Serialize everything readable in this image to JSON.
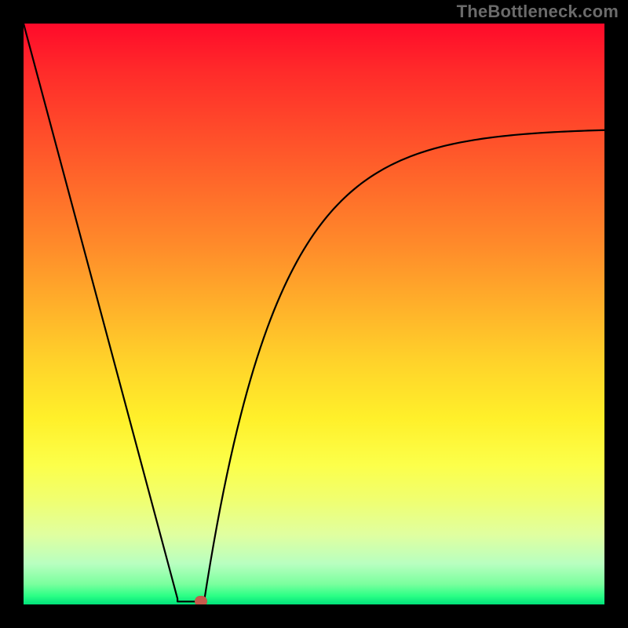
{
  "watermark": "TheBottleneck.com",
  "chart_data": {
    "type": "line",
    "title": "",
    "xlabel": "",
    "ylabel": "",
    "xlim": [
      0,
      100
    ],
    "ylim": [
      0,
      100
    ],
    "grid": false,
    "legend": false,
    "background_gradient": {
      "orientation": "vertical",
      "stops": [
        {
          "pos": 0.0,
          "color": "#ff0a2a"
        },
        {
          "pos": 0.5,
          "color": "#ffd22a"
        },
        {
          "pos": 0.82,
          "color": "#f0ff70"
        },
        {
          "pos": 1.0,
          "color": "#00e27a"
        }
      ]
    },
    "series": [
      {
        "name": "bottleneck-curve",
        "color": "#000000",
        "segments": [
          {
            "kind": "line",
            "x": [
              0,
              26.5
            ],
            "y": [
              100,
              1
            ]
          },
          {
            "kind": "line",
            "x": [
              26.5,
              31
            ],
            "y": [
              0.5,
              0.5
            ]
          },
          {
            "kind": "asymptotic_rise",
            "x_start": 31,
            "x_end": 100,
            "y_start": 0,
            "y_asymptote": 82,
            "initial_slope_approx": 6.5
          }
        ],
        "sampled_points": {
          "x": [
            0,
            5,
            10,
            15,
            20,
            25,
            26.5,
            28,
            31,
            35,
            40,
            45,
            50,
            55,
            60,
            65,
            70,
            75,
            80,
            85,
            90,
            95,
            100
          ],
          "y": [
            100,
            81,
            63,
            44,
            26,
            7,
            1,
            0.5,
            0.5,
            18,
            34,
            46,
            55,
            61,
            66,
            70,
            73,
            75.5,
            77.5,
            79,
            80,
            81,
            82
          ]
        }
      }
    ],
    "marker": {
      "x": 30.5,
      "y": 0.5,
      "color": "#c65a4c"
    }
  }
}
